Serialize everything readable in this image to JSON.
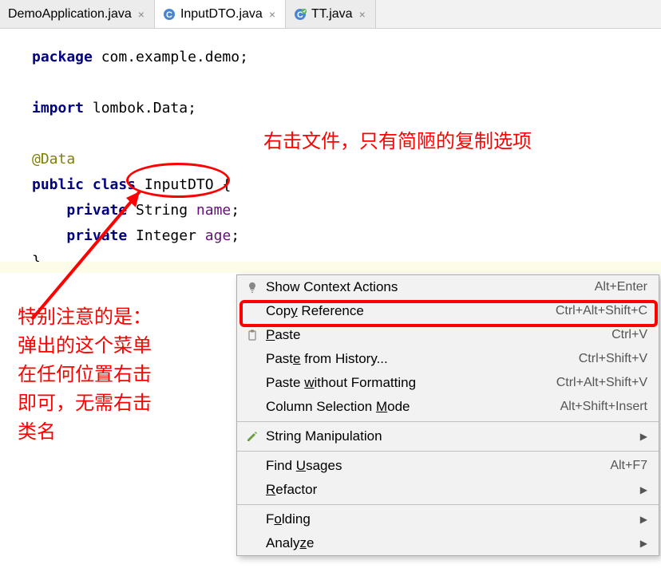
{
  "tabs": [
    {
      "label": "DemoApplication.java",
      "active": false,
      "icon": ""
    },
    {
      "label": "InputDTO.java",
      "active": true,
      "icon": "C"
    },
    {
      "label": "TT.java",
      "active": false,
      "icon": "C"
    }
  ],
  "code": {
    "l1_kw": "package",
    "l1_rest": " com.example.demo;",
    "l2_kw": "import",
    "l2_rest": " lombok.Data;",
    "l3": "@Data",
    "l4_kw1": "public",
    "l4_kw2": "class",
    "l4_name": "InputDTO",
    "l4_brace": " {",
    "l5_kw": "private",
    "l5_type": " String ",
    "l5_name": "name",
    "l5_end": ";",
    "l6_kw": "private",
    "l6_type": " Integer ",
    "l6_name": "age",
    "l6_end": ";",
    "l7": "}"
  },
  "annotations": {
    "top": "右击文件，只有简陋的复制选项",
    "left_l1": "特别注意的是：",
    "left_l2": "弹出的这个菜单",
    "left_l3": "在任何位置右击",
    "left_l4": "即可，无需右击",
    "left_l5": "类名"
  },
  "menu": {
    "items": [
      {
        "icon": "bulb",
        "label_pre": "",
        "ul": "",
        "label_post": "Show Context Actions",
        "shortcut": "Alt+Enter",
        "arrow": false
      },
      {
        "icon": "",
        "label_pre": "Cop",
        "ul": "y",
        "label_post": " Reference",
        "shortcut": "Ctrl+Alt+Shift+C",
        "arrow": false
      },
      {
        "icon": "paste",
        "label_pre": "",
        "ul": "P",
        "label_post": "aste",
        "shortcut": "Ctrl+V",
        "arrow": false
      },
      {
        "icon": "",
        "label_pre": "Past",
        "ul": "e",
        "label_post": " from History...",
        "shortcut": "Ctrl+Shift+V",
        "arrow": false
      },
      {
        "icon": "",
        "label_pre": "Paste ",
        "ul": "w",
        "label_post": "ithout Formatting",
        "shortcut": "Ctrl+Alt+Shift+V",
        "arrow": false
      },
      {
        "icon": "",
        "label_pre": "Column Selection ",
        "ul": "M",
        "label_post": "ode",
        "shortcut": "Alt+Shift+Insert",
        "arrow": false
      },
      {
        "sep": true
      },
      {
        "icon": "pencil",
        "label_pre": "String Manipulation",
        "ul": "",
        "label_post": "",
        "shortcut": "",
        "arrow": true
      },
      {
        "sep": true
      },
      {
        "icon": "",
        "label_pre": "Find ",
        "ul": "U",
        "label_post": "sages",
        "shortcut": "Alt+F7",
        "arrow": false
      },
      {
        "icon": "",
        "label_pre": "",
        "ul": "R",
        "label_post": "efactor",
        "shortcut": "",
        "arrow": true
      },
      {
        "sep": true
      },
      {
        "icon": "",
        "label_pre": "F",
        "ul": "o",
        "label_post": "lding",
        "shortcut": "",
        "arrow": true
      },
      {
        "icon": "",
        "label_pre": "Analy",
        "ul": "z",
        "label_post": "e",
        "shortcut": "",
        "arrow": true
      }
    ]
  }
}
